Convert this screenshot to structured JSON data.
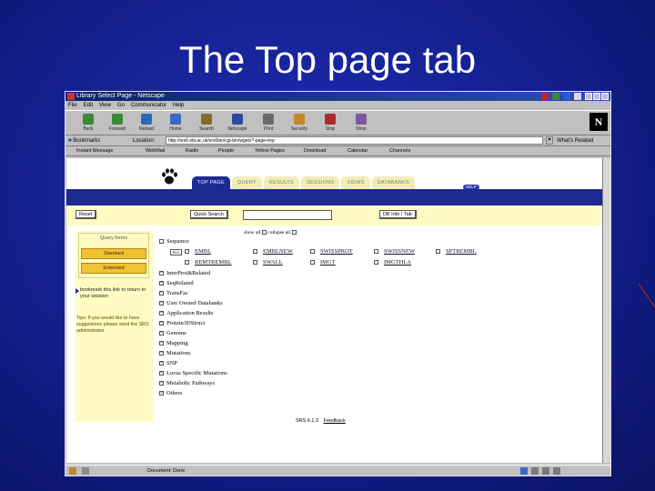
{
  "slide": {
    "title": "The Top page tab"
  },
  "browser": {
    "window_title": "Library Select Page - Netscape",
    "menu": [
      "File",
      "Edit",
      "View",
      "Go",
      "Communicator",
      "Help"
    ],
    "toolbar": [
      "Back",
      "Forward",
      "Reload",
      "Home",
      "Search",
      "Netscape",
      "Print",
      "Security",
      "Stop",
      "Shop"
    ],
    "bookmarks_label": "Bookmarks",
    "location_label": "Location:",
    "location_url": "http://srs6.ebi.ac.uk/srs6bin/cgi-bin/wgetz?-page+top",
    "whats_related": "What's Related",
    "personal_toolbar": [
      "Instant Message",
      "WebMail",
      "Radio",
      "People",
      "Yellow Pages",
      "Download",
      "Calendar",
      "Channels"
    ],
    "status_text": "Document: Done"
  },
  "page": {
    "tabs": [
      "TOP PAGE",
      "QUERY",
      "RESULTS",
      "SESSIONS",
      "VIEWS",
      "DATABANKS"
    ],
    "help_label": "HELP",
    "reset_label": "Reset",
    "quick_search_label": "Quick Search",
    "db_info_label": "DB Info / Tab",
    "showall_text": "show all",
    "collapse_text": "collapse all",
    "sidebar": {
      "query_forms_title": "Query forms",
      "standard_label": "Standard",
      "extended_label": "Extended",
      "bookmark_text": "bookmark this link to return to your session",
      "hint_text": "Tips: If you would like to have suggestions please send the SRS administrator"
    },
    "all_label": "ALL",
    "sequence_label": "Sequence",
    "sequence_dbs_row1": [
      "EMBL",
      "EMBLNEW",
      "SWISSPROT",
      "SWISSNEW",
      "SPTREMBL"
    ],
    "sequence_dbs_row2": [
      "REMTREMBL",
      "SWALL",
      "IMGT",
      "IMGTHLA"
    ],
    "categories": [
      "InterProt&Related",
      "SeqRelated",
      "TransFac",
      "User Owned Databanks",
      "Application Results",
      "Protein3DStruct",
      "Genome",
      "Mapping",
      "Mutations",
      "SNP",
      "Locus Specific Mutations",
      "Metabolic Pathways",
      "Others"
    ],
    "footer_prefix": "SRS 6.1.3",
    "footer_link": "Feedback"
  }
}
